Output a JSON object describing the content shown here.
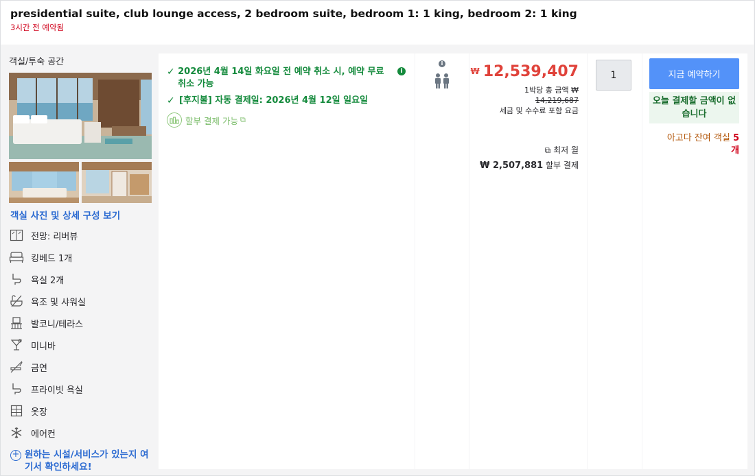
{
  "header": {
    "room_title": "presidential suite, club lounge access, 2 bedroom suite, bedroom 1: 1 king, bedroom 2: 1 king",
    "booked_note": "3시간 전 예약됨"
  },
  "room": {
    "type_label": "객실/투숙 공간",
    "photo_link": "객실 사진 및 상세 구성 보기",
    "amenities": [
      {
        "icon": "view-icon",
        "label": "전망: 리버뷰"
      },
      {
        "icon": "bed-icon",
        "label": "킹베드 1개"
      },
      {
        "icon": "bathroom-icon",
        "label": "욕실 2개"
      },
      {
        "icon": "bathtub-shower-icon",
        "label": "욕조 및 샤워실"
      },
      {
        "icon": "balcony-icon",
        "label": "발코니/테라스"
      },
      {
        "icon": "minibar-icon",
        "label": "미니바"
      },
      {
        "icon": "no-smoking-icon",
        "label": "금연"
      },
      {
        "icon": "private-bathroom-icon",
        "label": "프라이빗 욕실"
      },
      {
        "icon": "wardrobe-icon",
        "label": "옷장"
      },
      {
        "icon": "air-conditioning-icon",
        "label": "에어컨"
      }
    ],
    "facility_link": "원하는 시설/서비스가 있는지 여기서 확인하세요!"
  },
  "policy": {
    "free_cancel": "2026년 4월 14일 화요일 전 예약 취소 시, 예약 무료 취소 가능",
    "pay_later": "[후지불] 자동 결제일: 2026년 4월 12일 일요일",
    "installment": "할부 결제 가능"
  },
  "price": {
    "currency_symbol": "₩",
    "amount": "12,539,407",
    "per_night_label": "1박당 총 금액",
    "original_symbol": "₩",
    "original_amount": "14,219,687",
    "tax_note": "세금 및 수수료 포함 요금",
    "min_month_label": "최저 월",
    "monthly_amount": "₩ 2,507,881",
    "monthly_suffix": "할부 결제"
  },
  "quantity": {
    "value": "1"
  },
  "booking": {
    "button_label": "지금 예약하기",
    "pay_today": "오늘 결제할 금액이 없습니다",
    "rooms_left_prefix": "아고다 잔여 객실",
    "rooms_left_count": "5",
    "rooms_left_suffix": "개"
  },
  "colors": {
    "accent_blue": "#5392f9",
    "price_red": "#e0433b",
    "green": "#148a3c"
  }
}
